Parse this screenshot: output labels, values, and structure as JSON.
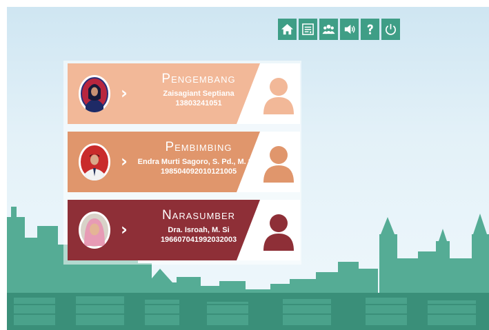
{
  "colors": {
    "toolbar": "#3f9e86",
    "city": "#55ac95",
    "city_dark": "#3a8f79",
    "pengembang": "#f2b898",
    "pembimbing": "#e0966c",
    "narasumber": "#8e2f37"
  },
  "toolbar": {
    "buttons": [
      {
        "id": "home",
        "icon": "home-icon"
      },
      {
        "id": "menu",
        "icon": "list-icon"
      },
      {
        "id": "profile",
        "icon": "users-icon"
      },
      {
        "id": "sound",
        "icon": "speaker-icon"
      },
      {
        "id": "help",
        "icon": "question-icon"
      },
      {
        "id": "exit",
        "icon": "power-icon"
      }
    ]
  },
  "cards": [
    {
      "role": "Pengembang",
      "name": "Zaisagiant Septiana",
      "id": "13803241051",
      "color": "#f2b898",
      "icon": "chevron-right-icon"
    },
    {
      "role": "Pembimbing",
      "name": "Endra Murti Sagoro, S. Pd., M. Sc.",
      "id": "198504092010121005",
      "color": "#e0966c",
      "icon": "chevron-right-icon"
    },
    {
      "role": "Narasumber",
      "name": "Dra. Isroah, M. Si",
      "id": "196607041992032003",
      "color": "#8e2f37",
      "icon": "chevron-right-icon"
    }
  ]
}
